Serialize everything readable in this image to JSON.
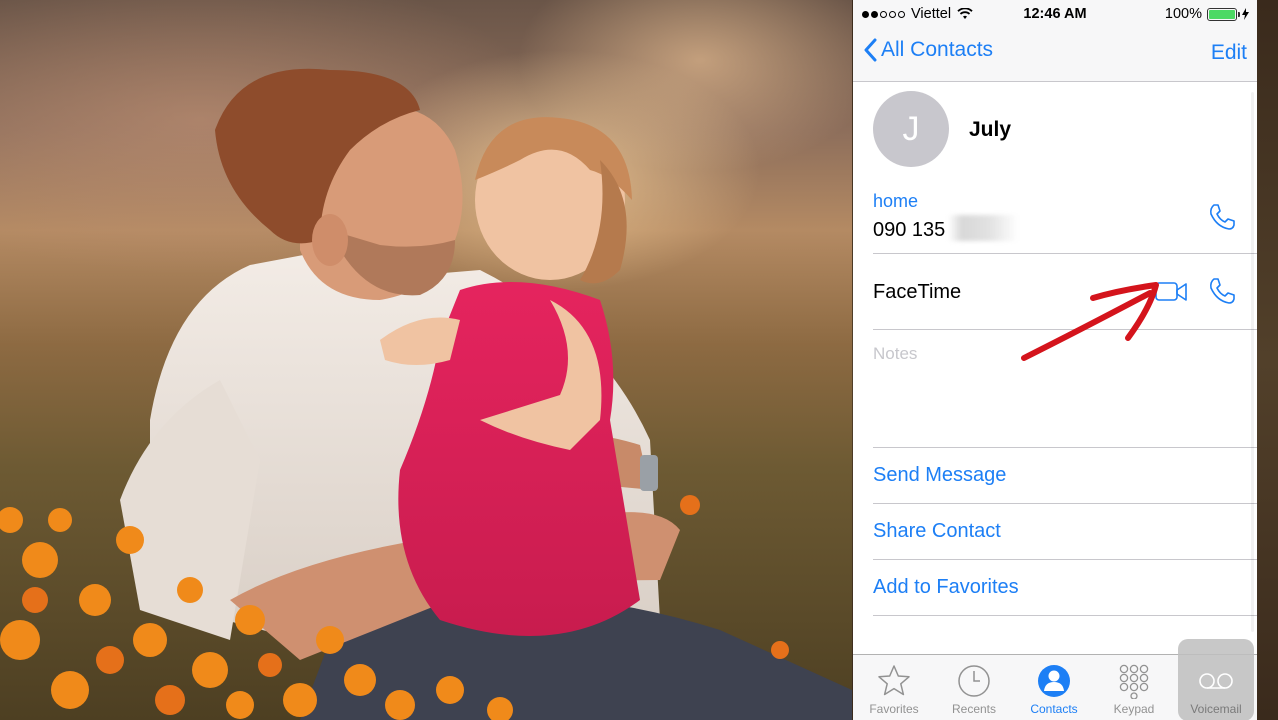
{
  "status_bar": {
    "carrier": "Viettel",
    "time": "12:46 AM",
    "battery": "100%",
    "signal_dots_filled": 2,
    "signal_dots_total": 5
  },
  "nav": {
    "back_label": "All Contacts",
    "edit_label": "Edit"
  },
  "contact": {
    "initial": "J",
    "name": "July",
    "phone_label": "home",
    "phone_number": "090 135",
    "facetime_label": "FaceTime",
    "notes_placeholder": "Notes"
  },
  "actions": [
    {
      "label": "Send Message"
    },
    {
      "label": "Share Contact"
    },
    {
      "label": "Add to Favorites"
    }
  ],
  "tabs": [
    {
      "label": "Favorites",
      "icon": "star-icon"
    },
    {
      "label": "Recents",
      "icon": "clock-icon"
    },
    {
      "label": "Contacts",
      "icon": "person-icon"
    },
    {
      "label": "Keypad",
      "icon": "keypad-icon"
    },
    {
      "label": "Voicemail",
      "icon": "voicemail-icon"
    }
  ],
  "colors": {
    "accent": "#1d7ff5",
    "annotation_arrow": "#d4141c"
  }
}
